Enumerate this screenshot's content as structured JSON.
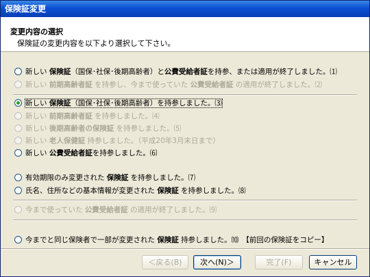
{
  "title": "保険証変更",
  "header": {
    "heading": "変更内容の選択",
    "subtitle": "保険証の変更内容を以下より選択して下さい。"
  },
  "options": [
    {
      "pre": "新しい ",
      "b1": "保険証",
      "mid": "（国保･社保･後期高齢者）と",
      "b2": "公費受給者証",
      "post": "を持参、または適用が終了しました。⑴"
    },
    {
      "pre": "新しい ",
      "b1": "前期高齢者証",
      "mid": " を持参し、今まで使っていた ",
      "b2": "公費受給者証",
      "post": " の適用が終了しました。⑵"
    },
    {
      "pre": "新しい ",
      "b1": "保険証",
      "mid": "（国保･社保･後期高齢者）を持参しました。⑶",
      "b2": "",
      "post": ""
    },
    {
      "pre": "新しい ",
      "b1": "前期高齢者証",
      "mid": " を持参しました。⑷",
      "b2": "",
      "post": ""
    },
    {
      "pre": "新しい ",
      "b1": "後期高齢者の保険証",
      "mid": " を持参しました。⑸",
      "b2": "",
      "post": ""
    },
    {
      "pre": "新しい ",
      "b1": "老人保健証",
      "mid": " 持参しました。（平成20年3月末日まで）",
      "b2": "",
      "post": ""
    },
    {
      "pre": "新しい ",
      "b1": "公費受給者証",
      "mid": "を持参しました。⑹",
      "b2": "",
      "post": ""
    },
    {
      "pre": "有効期限のみ変更された ",
      "b1": "保険証",
      "mid": " を持参しました。⑺",
      "b2": "",
      "post": ""
    },
    {
      "pre": "氏名、住所などの基本情報が変更された ",
      "b1": "保険証",
      "mid": " を持参しました。⑻",
      "b2": "",
      "post": ""
    },
    {
      "pre": "今まで使っていた ",
      "b1": "公費受給者証",
      "mid": " の適用が終了しました。⑼",
      "b2": "",
      "post": ""
    },
    {
      "pre": "今までと同じ保険者で一部が変更された ",
      "b1": "保険証",
      "mid": " 持参しました。⑽　【前回の保険証をコピー】",
      "b2": "",
      "post": ""
    }
  ],
  "buttons": {
    "back": "＜戻る(B)",
    "next": "次へ(N)＞",
    "finish": "完了(F)",
    "cancel": "キャンセル"
  }
}
